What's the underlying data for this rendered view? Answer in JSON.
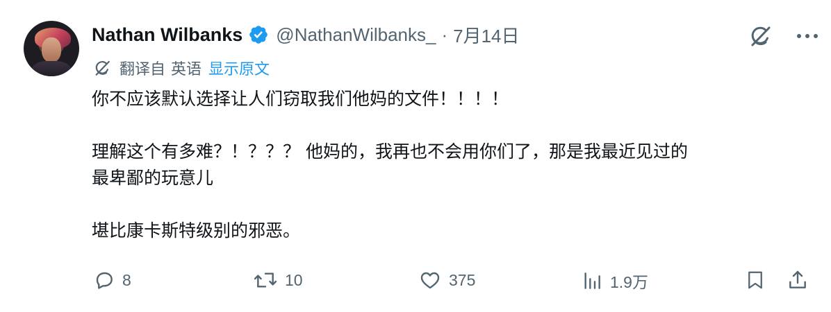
{
  "tweet": {
    "author_name": "Nathan Wilbanks",
    "handle": "@NathanWilbanks_",
    "separator": "·",
    "date": "7月14日",
    "translation": {
      "label": "翻译自",
      "language": "英语",
      "show_original": "显示原文"
    },
    "paragraphs": [
      "你不应该默认选择让人们窃取我们他妈的文件！！！！",
      "理解这个有多难？！？？？ 他妈的，我再也不会用你们了，那是我最近见过的",
      "最卑鄙的玩意儿",
      "堪比康卡斯特级别的邪恶。"
    ],
    "actions": {
      "replies": "8",
      "reposts": "10",
      "likes": "375",
      "views": "1.9万"
    }
  },
  "colors": {
    "text": "#0f1419",
    "secondary": "#536471",
    "link": "#1d9bf0",
    "verified": "#1d9bf0"
  },
  "icons": {
    "verified": "verified-badge-icon",
    "grok": "grok-icon",
    "more": "more-options-icon",
    "translate": "translate-icon",
    "reply": "reply-icon",
    "repost": "repost-icon",
    "like": "like-icon",
    "views": "views-icon",
    "bookmark": "bookmark-icon",
    "share": "share-icon"
  }
}
